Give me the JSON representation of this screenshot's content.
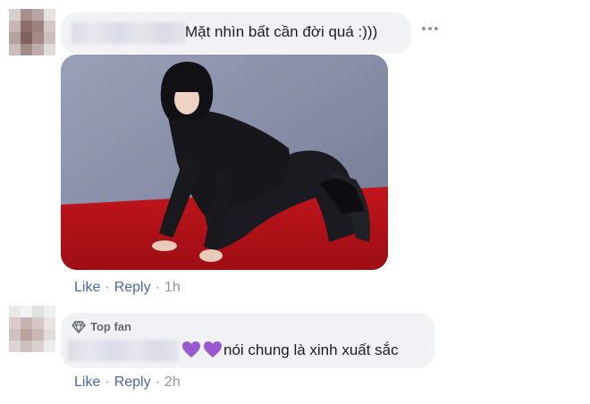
{
  "comments": [
    {
      "text": "Mặt nhìn bất cần đời quá :)))",
      "like_label": "Like",
      "reply_label": "Reply",
      "time": "1h",
      "more_icon": "more-horizontal-icon"
    },
    {
      "badge_label": "Top fan",
      "badge_icon": "diamond-icon",
      "emoji": "purple-heart-emoji",
      "text": "nói chung là xinh xuất sắc",
      "like_label": "Like",
      "reply_label": "Reply",
      "time": "2h"
    }
  ],
  "separator": "·",
  "colors": {
    "link": "#4b67a1",
    "meta": "#90949c",
    "bubble": "#f0f2f5",
    "heart": "#9b59d0"
  }
}
